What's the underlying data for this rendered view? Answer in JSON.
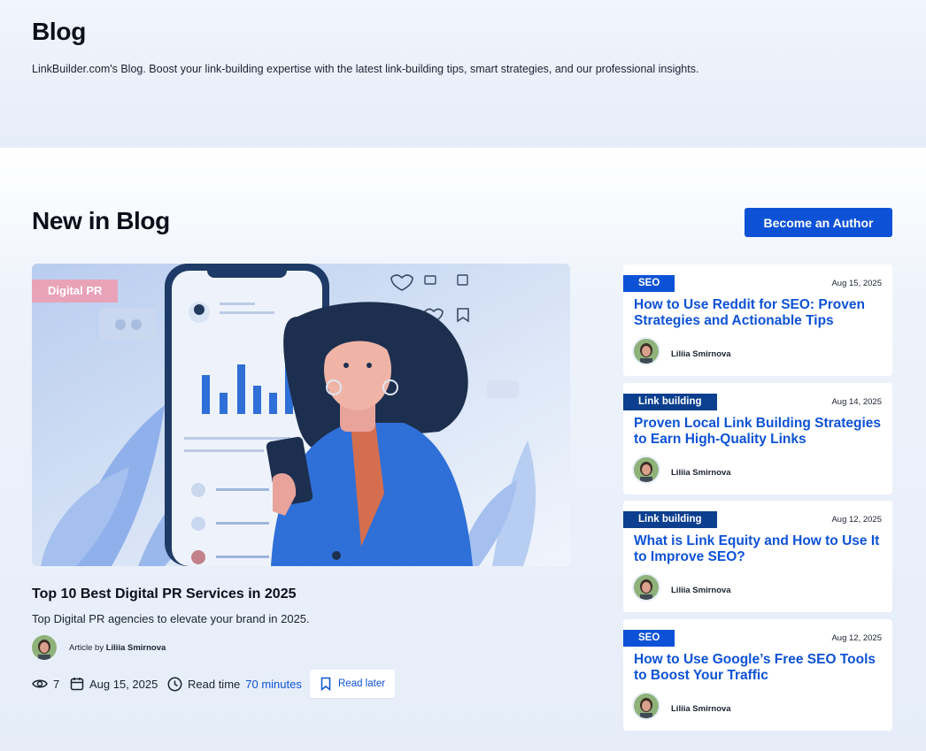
{
  "header": {
    "title": "Blog",
    "description": "LinkBuilder.com's Blog. Boost your link-building expertise with the latest link-building tips, smart strategies, and our professional insights."
  },
  "section": {
    "title": "New in Blog",
    "author_button": "Become an Author"
  },
  "featured": {
    "tag": "Digital PR",
    "title": "Top 10 Best Digital PR Services in 2025",
    "description": "Top Digital PR agencies to elevate your brand in 2025.",
    "author_prefix": "Article by",
    "author": "Liliia Smirnova",
    "views": "7",
    "date": "Aug 15, 2025",
    "read_time_label": "Read time",
    "read_time_value": "70 minutes",
    "read_later": "Read later"
  },
  "cards": [
    {
      "tag": "SEO",
      "date": "Aug 15, 2025",
      "title": "How to Use Reddit for SEO: Proven Strategies and Actionable Tips",
      "author": "Liliia Smirnova"
    },
    {
      "tag": "Link building",
      "date": "Aug 14, 2025",
      "title": "Proven Local Link Building Strategies to Earn High-Quality Links",
      "author": "Liliia Smirnova"
    },
    {
      "tag": "Link building",
      "date": "Aug 12, 2025",
      "title": "What is Link Equity and How to Use It to Improve SEO?",
      "author": "Liliia Smirnova"
    },
    {
      "tag": "SEO",
      "date": "Aug 12, 2025",
      "title": "How to Use Google’s Free SEO Tools to Boost Your Traffic",
      "author": "Liliia Smirnova"
    }
  ],
  "colors": {
    "accent": "#0d52d6",
    "tag_dark": "#0c3f8e",
    "tag_pink": "#e8a3b8"
  },
  "icons": [
    "eye-icon",
    "calendar-icon",
    "clock-icon",
    "bookmark-icon"
  ]
}
